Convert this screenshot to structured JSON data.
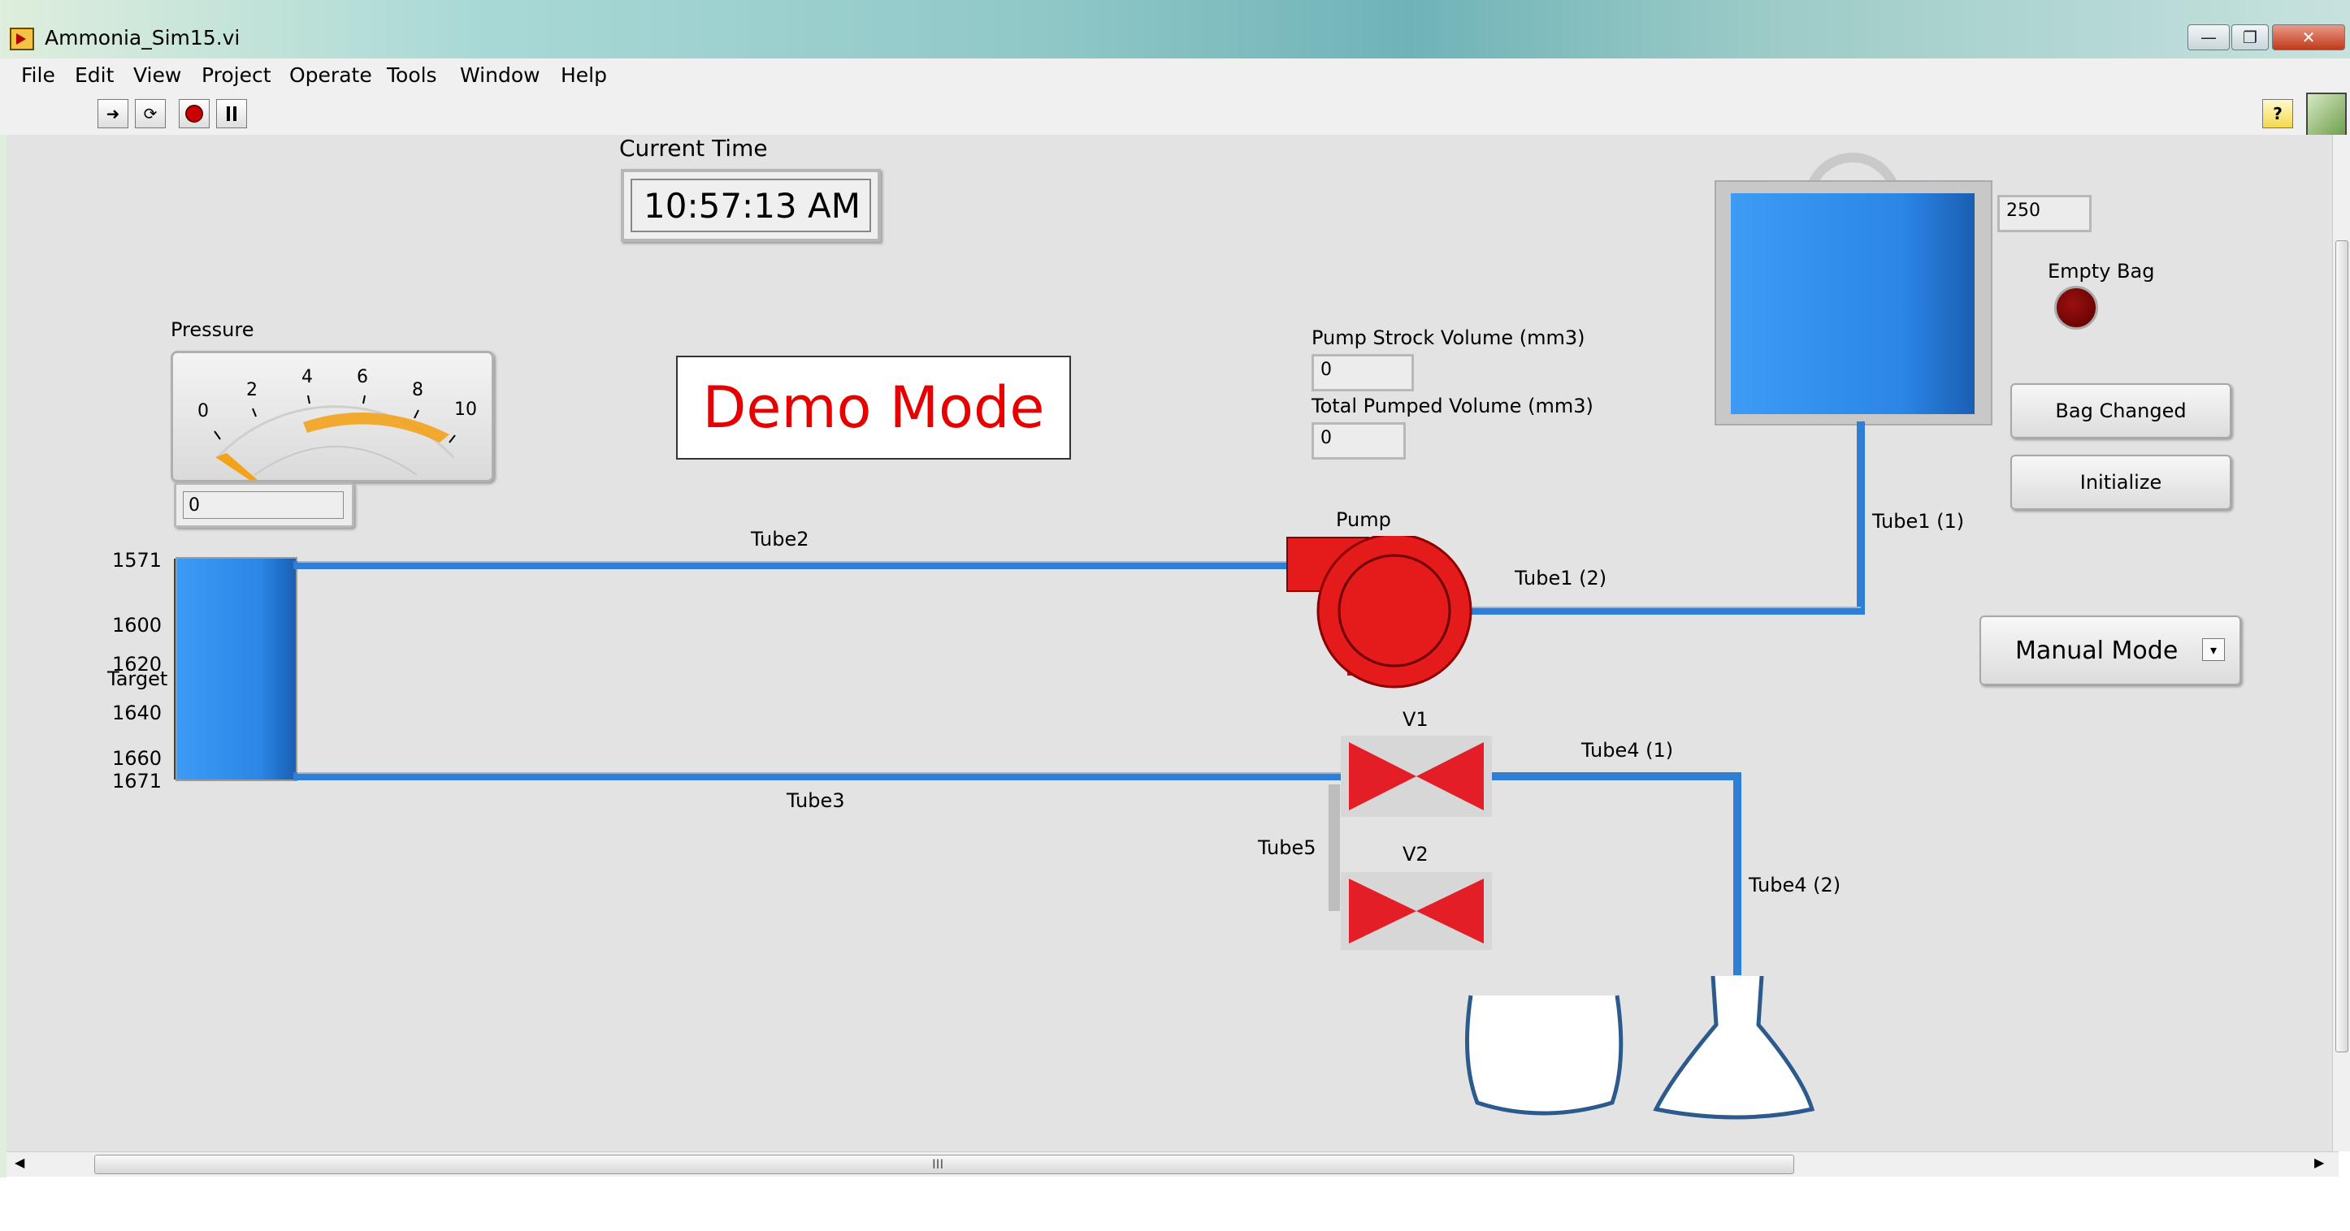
{
  "window": {
    "title": "Ammonia_Sim15.vi"
  },
  "menu": [
    "File",
    "Edit",
    "View",
    "Project",
    "Operate",
    "Tools",
    "Window",
    "Help"
  ],
  "toolbar": {
    "help_glyph": "?"
  },
  "panel": {
    "current_time_label": "Current Time",
    "current_time": "10:57:13 AM",
    "pressure_label": "Pressure",
    "pressure_ticks": [
      "0",
      "2",
      "4",
      "6",
      "8",
      "10"
    ],
    "pressure_value_text": "0",
    "pressure_value": 0,
    "demo_mode": "Demo Mode",
    "pump_stroke_label": "Pump Strock Volume (mm3)",
    "pump_stroke_value": "0",
    "total_pumped_label": "Total Pumped Volume (mm3)",
    "total_pumped_value": "0",
    "bag_value": "250",
    "empty_bag_label": "Empty Bag",
    "bag_changed_label": "Bag Changed",
    "initialize_label": "Initialize",
    "mode_select": "Manual Mode",
    "pump_label": "Pump",
    "tube_labels": {
      "tube1_1": "Tube1 (1)",
      "tube1_2": "Tube1 (2)",
      "tube2": "Tube2",
      "tube3": "Tube3",
      "tube4_1": "Tube4 (1)",
      "tube4_2": "Tube4 (2)",
      "tube5": "Tube5"
    },
    "valve_labels": {
      "v1": "V1",
      "v2": "V2"
    },
    "column_scale": {
      "ticks": [
        "1571",
        "1600",
        "1620",
        "1640",
        "1660",
        "1671"
      ],
      "target_label": "Target"
    }
  },
  "scroll": {
    "thumb_glyph": "III"
  },
  "colors": {
    "panel_bg": "#e3e3e3",
    "tube_blue": "#2f7fd7",
    "bag_blue": "#2b86e6",
    "pump_red": "#e51a1a",
    "valve_red": "#e31e26",
    "demo_red": "#e60000",
    "gauge_orange": "#f2a21b",
    "led_dark_red": "#6b0000"
  },
  "icons": {
    "run": "run-arrow-icon",
    "run_continuous": "run-continuous-icon",
    "abort": "abort-icon",
    "pause": "pause-icon",
    "help": "help-icon",
    "vi": "vi-icon"
  }
}
